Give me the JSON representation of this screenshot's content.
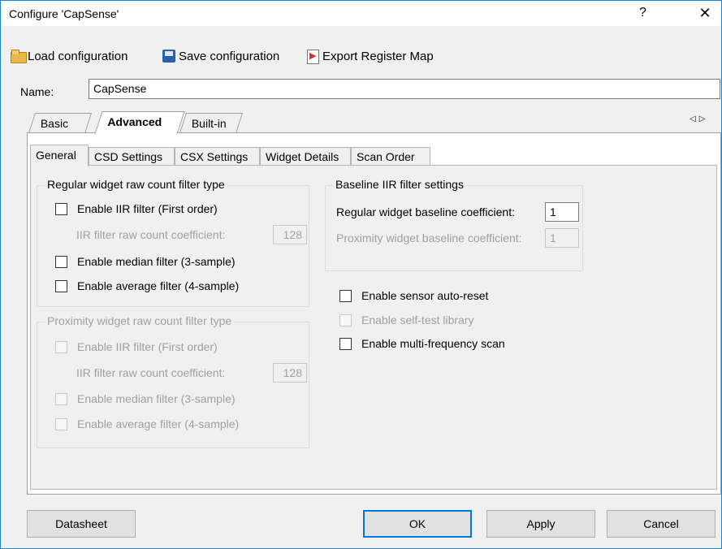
{
  "window": {
    "title": "Configure 'CapSense'",
    "help_glyph": "?",
    "close_glyph": "✕"
  },
  "toolbar": {
    "load_label": "Load configuration",
    "save_label": "Save configuration",
    "export_label": "Export Register Map"
  },
  "name": {
    "label": "Name:",
    "value": "CapSense"
  },
  "outer_tabs": {
    "basic": "Basic",
    "advanced": "Advanced",
    "builtin": "Built-in",
    "scroll_glyph": "◁▷"
  },
  "inner_tabs": {
    "general": "General",
    "csd": "CSD Settings",
    "csx": "CSX Settings",
    "widget_details": "Widget Details",
    "scan_order": "Scan Order"
  },
  "regular_filter": {
    "title": "Regular widget raw count filter type",
    "iir_label": "Enable IIR filter (First order)",
    "iir_coef_label": "IIR filter raw count coefficient:",
    "iir_coef_value": "128",
    "median_label": "Enable median filter (3-sample)",
    "average_label": "Enable average filter (4-sample)"
  },
  "proximity_filter": {
    "title": "Proximity widget raw count filter type",
    "iir_label": "Enable IIR filter (First order)",
    "iir_coef_label": "IIR filter raw count coefficient:",
    "iir_coef_value": "128",
    "median_label": "Enable median filter (3-sample)",
    "average_label": "Enable average filter (4-sample)"
  },
  "baseline": {
    "title": "Baseline IIR filter settings",
    "regular_label": "Regular widget baseline coefficient:",
    "regular_value": "1",
    "proximity_label": "Proximity widget baseline coefficient:",
    "proximity_value": "1"
  },
  "options": {
    "auto_reset": "Enable sensor auto-reset",
    "self_test": "Enable self-test library",
    "multi_freq": "Enable multi-frequency scan"
  },
  "buttons": {
    "datasheet": "Datasheet",
    "ok": "OK",
    "apply": "Apply",
    "cancel": "Cancel"
  },
  "colors": {
    "accent": "#0078d7",
    "disabled_text": "#a0a0a0",
    "window_border": "#1883d7"
  }
}
